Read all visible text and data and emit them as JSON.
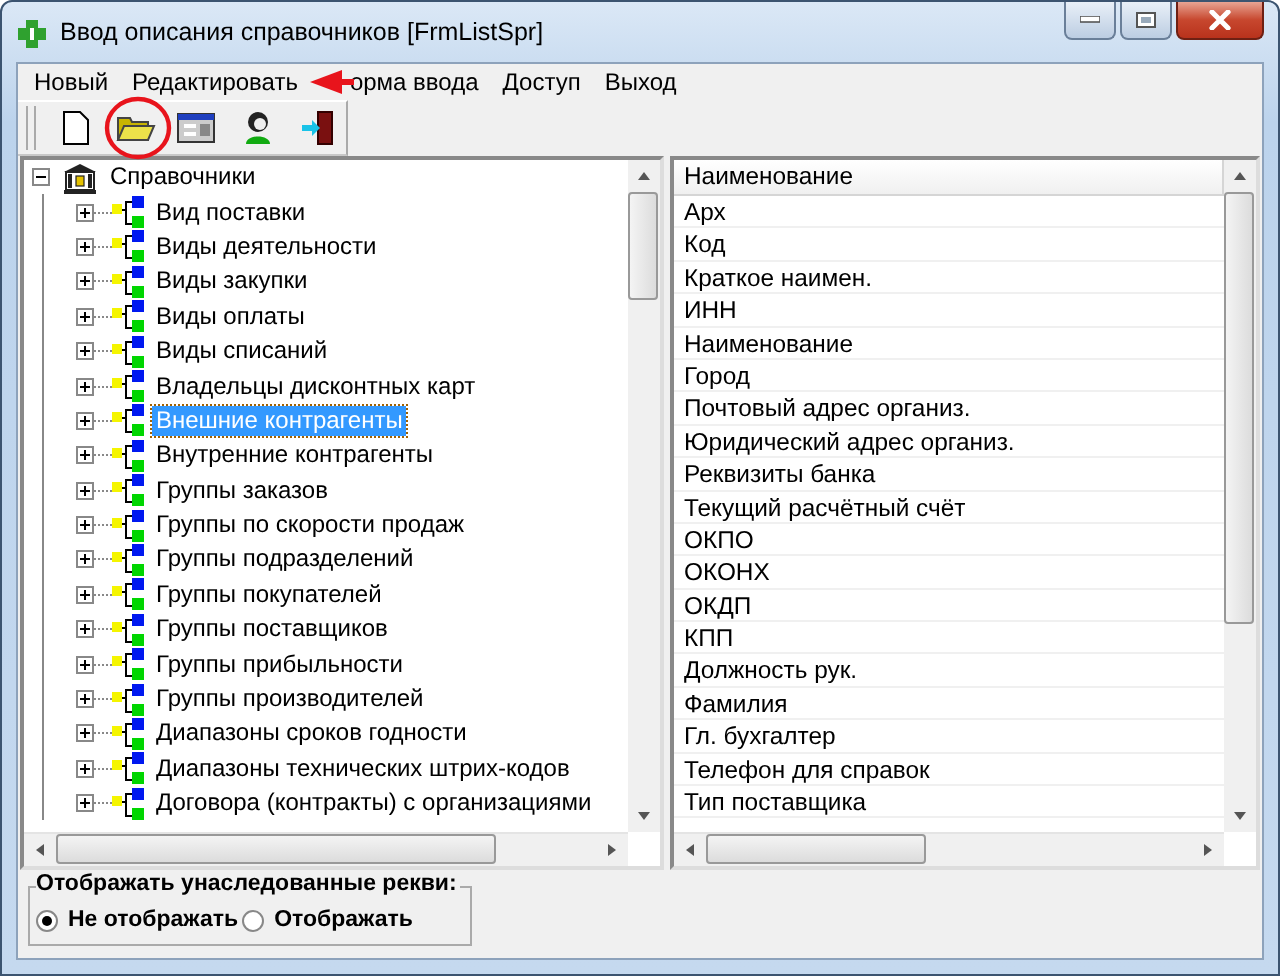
{
  "window": {
    "title": "Ввод описания справочников [FrmListSpr]"
  },
  "menu": [
    {
      "label": "Новый"
    },
    {
      "label": "Редактировать"
    },
    {
      "label": "орма ввода"
    },
    {
      "label": "Доступ"
    },
    {
      "label": "Выход"
    }
  ],
  "toolbar": [
    {
      "kind": "new"
    },
    {
      "kind": "open"
    },
    {
      "kind": "form"
    },
    {
      "kind": "user"
    },
    {
      "kind": "exit"
    }
  ],
  "tree": {
    "label": "Справочники",
    "expanded": true,
    "children": [
      {
        "label": "Вид поставки",
        "expanded": false,
        "selected": false
      },
      {
        "label": "Виды деятельности",
        "expanded": false,
        "selected": false
      },
      {
        "label": "Виды закупки",
        "expanded": false,
        "selected": false
      },
      {
        "label": "Виды оплаты",
        "expanded": false,
        "selected": false
      },
      {
        "label": "Виды списаний",
        "expanded": false,
        "selected": false
      },
      {
        "label": "Владельцы дисконтных карт",
        "expanded": false,
        "selected": false
      },
      {
        "label": "Внешние контрагенты",
        "expanded": false,
        "selected": true
      },
      {
        "label": "Внутренние контрагенты",
        "expanded": false,
        "selected": false
      },
      {
        "label": "Группы заказов",
        "expanded": false,
        "selected": false
      },
      {
        "label": "Группы по скорости продаж",
        "expanded": false,
        "selected": false
      },
      {
        "label": "Группы подразделений",
        "expanded": false,
        "selected": false
      },
      {
        "label": "Группы покупателей",
        "expanded": false,
        "selected": false
      },
      {
        "label": "Группы поставщиков",
        "expanded": false,
        "selected": false
      },
      {
        "label": "Группы прибыльности",
        "expanded": false,
        "selected": false
      },
      {
        "label": "Группы производителей",
        "expanded": false,
        "selected": false
      },
      {
        "label": "Диапазоны сроков годности",
        "expanded": false,
        "selected": false
      },
      {
        "label": "Диапазоны технических штрих-кодов",
        "expanded": false,
        "selected": false
      },
      {
        "label": "Договора (контракты) с организациями",
        "expanded": false,
        "selected": false
      }
    ]
  },
  "fields": {
    "column": "Наименование",
    "rows": [
      "Арх",
      "Код",
      "Краткое наимен.",
      "ИНН",
      "Наименование",
      "Город",
      "Почтовый адрес организ.",
      "Юридический адрес организ.",
      "Реквизиты банка",
      "Текущий расчётный счёт",
      "ОКПО",
      "ОКОНХ",
      "ОКДП",
      "КПП",
      "Должность рук.",
      "Фамилия",
      "Гл. бухгалтер",
      "Телефон для справок",
      "Тип поставщика"
    ]
  },
  "inherited": {
    "title": "Отображать унаследованные рекви:",
    "options": [
      {
        "label": "Не отображать",
        "selected": true
      },
      {
        "label": "Отображать",
        "selected": false
      }
    ]
  }
}
